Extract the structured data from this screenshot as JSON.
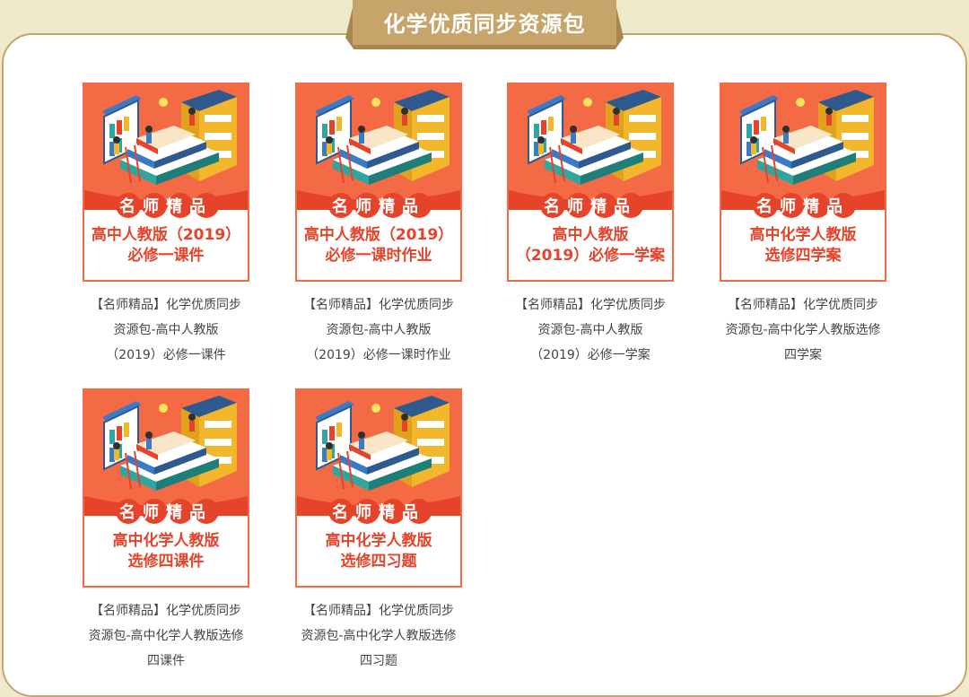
{
  "header": {
    "title": "化学优质同步资源包"
  },
  "colors": {
    "background": "#efeacb",
    "accent": "#c6a46a",
    "thumb_orange": "#f46a44",
    "thumb_red": "#e5432a"
  },
  "cards": [
    {
      "badge": "名师精品",
      "subtitle": "高中人教版（2019）\n必修一课件",
      "caption": "【名师精品】化学优质同步\n资源包-高中人教版\n（2019）必修一课件"
    },
    {
      "badge": "名师精品",
      "subtitle": "高中人教版（2019）\n必修一课时作业",
      "caption": "【名师精品】化学优质同步\n资源包-高中人教版\n（2019）必修一课时作业"
    },
    {
      "badge": "名师精品",
      "subtitle": "高中人教版\n（2019）必修一学案",
      "caption": "【名师精品】化学优质同步\n资源包-高中人教版\n（2019）必修一学案"
    },
    {
      "badge": "名师精品",
      "subtitle": "高中化学人教版\n选修四学案",
      "caption": "【名师精品】化学优质同步\n资源包-高中化学人教版选修\n四学案"
    },
    {
      "badge": "名师精品",
      "subtitle": "高中化学人教版\n选修四课件",
      "caption": "【名师精品】化学优质同步\n资源包-高中化学人教版选修\n四课件"
    },
    {
      "badge": "名师精品",
      "subtitle": "高中化学人教版\n选修四习题",
      "caption": "【名师精品】化学优质同步\n资源包-高中化学人教版选修\n四习题"
    }
  ]
}
